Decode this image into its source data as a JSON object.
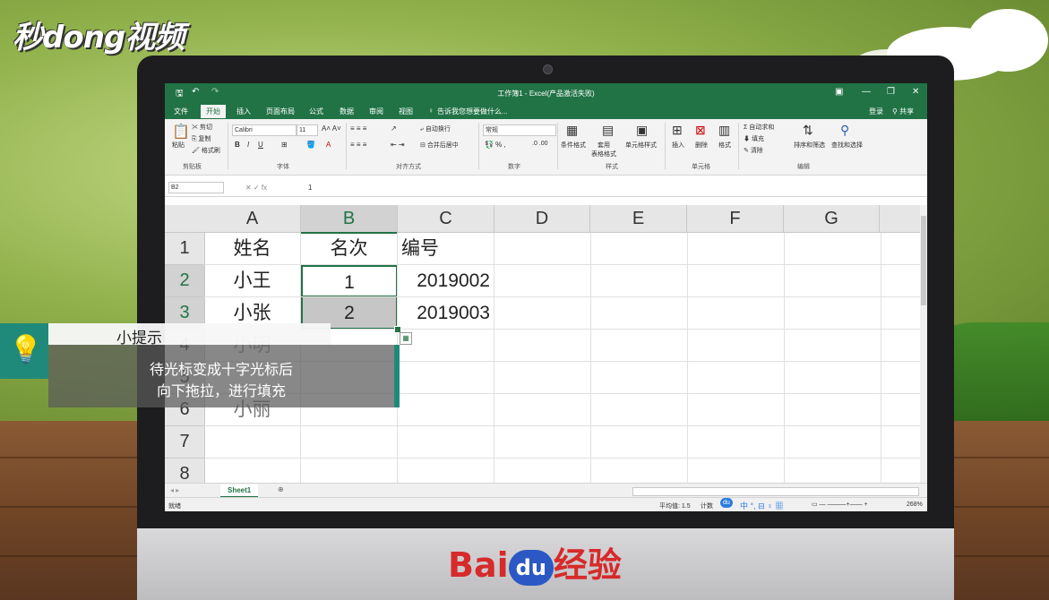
{
  "watermark_top_left": "秒dong视频",
  "watermark_bottom": {
    "left": "Bai",
    "badge": "du",
    "right": "经验"
  },
  "excel": {
    "title": "工作簿1 - Excel(产品激活失败)",
    "tabs": [
      "文件",
      "开始",
      "插入",
      "页面布局",
      "公式",
      "数据",
      "审阅",
      "视图"
    ],
    "active_tab": "开始",
    "tell_me": "告诉我您想要做什么...",
    "login": "登录",
    "share": "共享",
    "ribbon": {
      "clipboard": {
        "paste": "粘贴",
        "cut": "剪切",
        "copy": "复制",
        "format_painter": "格式刷",
        "group": "剪贴板"
      },
      "font": {
        "name": "Calibri",
        "size": "11",
        "group": "字体"
      },
      "alignment": {
        "wrap": "自动换行",
        "merge": "合并后居中",
        "group": "对齐方式"
      },
      "number": {
        "format": "常规",
        "group": "数字"
      },
      "styles": {
        "conditional": "条件格式",
        "table": "套用\n表格格式",
        "cell_styles": "单元格样式",
        "group": "样式"
      },
      "cells": {
        "insert": "插入",
        "delete": "删除",
        "format": "格式",
        "group": "单元格"
      },
      "editing": {
        "autosum": "自动求和",
        "fill": "填充",
        "clear": "清除",
        "sort": "排序和筛选",
        "find": "查找和选择",
        "group": "编辑"
      }
    },
    "name_box": "B2",
    "formula_value": "1",
    "columns": [
      "A",
      "B",
      "C",
      "D",
      "E",
      "F",
      "G"
    ],
    "rows": [
      "1",
      "2",
      "3",
      "4",
      "5",
      "6",
      "7",
      "8"
    ],
    "cells": {
      "A1": "姓名",
      "B1": "名次",
      "C1": "编号",
      "A2": "小王",
      "B2": "1",
      "C2": "2019002",
      "A3": "小张",
      "B3": "2",
      "C3": "2019003",
      "A4": "小明",
      "A6": "小丽"
    },
    "sheet_tab": "Sheet1",
    "status": {
      "ready": "就绪",
      "average": "平均值: 1.5",
      "count": "计数",
      "zoom": "268%"
    }
  },
  "tip": {
    "title": "小提示",
    "line1": "待光标变成十字光标后",
    "line2": "向下拖拉，进行填充"
  },
  "colors": {
    "excel_green": "#217346",
    "tip_teal": "#1f8a7a"
  }
}
